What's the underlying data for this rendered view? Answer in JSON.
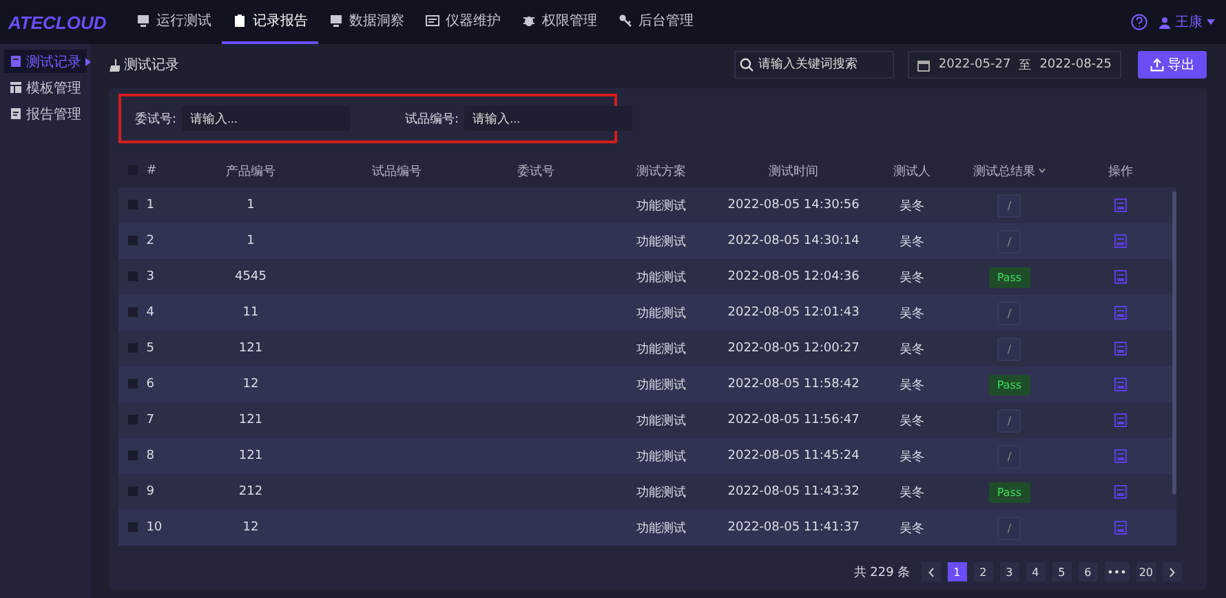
{
  "topbar": {
    "logo": "ATECLOUD",
    "nav": [
      {
        "label": "运行测试",
        "selected": false
      },
      {
        "label": "记录报告",
        "selected": true
      },
      {
        "label": "数据洞察",
        "selected": false
      },
      {
        "label": "仪器维护",
        "selected": false
      },
      {
        "label": "权限管理",
        "selected": false
      },
      {
        "label": "后台管理",
        "selected": false
      }
    ],
    "user": "王康"
  },
  "sidebar": {
    "items": [
      {
        "label": "测试记录",
        "selected": true
      },
      {
        "label": "模板管理",
        "selected": false
      },
      {
        "label": "报告管理",
        "selected": false
      }
    ]
  },
  "breadcrumb": "测试记录",
  "search": {
    "placeholder": "请输入关键词搜索"
  },
  "date_range": {
    "start": "2022-05-27",
    "separator": "至",
    "end": "2022-08-25"
  },
  "export_button": "导出",
  "filters": [
    {
      "label": "委试号:",
      "placeholder": "请输入..."
    },
    {
      "label": "试品编号:",
      "placeholder": "请输入..."
    }
  ],
  "table": {
    "select_all_checked": false,
    "columns": [
      "#",
      "产品编号",
      "试品编号",
      "委试号",
      "测试方案",
      "测试时间",
      "测试人",
      "测试总结果",
      "操作"
    ],
    "rows": [
      {
        "checked": false,
        "no": "1",
        "product": "1",
        "plan": "功能测试",
        "time": "2022-08-05 14:30:56",
        "tester": "吴冬",
        "result": {
          "kind": "none",
          "text": "/"
        }
      },
      {
        "checked": false,
        "no": "2",
        "product": "1",
        "plan": "功能测试",
        "time": "2022-08-05 14:30:14",
        "tester": "吴冬",
        "result": {
          "kind": "none",
          "text": "/"
        }
      },
      {
        "checked": false,
        "no": "3",
        "product": "4545",
        "plan": "功能测试",
        "time": "2022-08-05 12:04:36",
        "tester": "吴冬",
        "result": {
          "kind": "pass",
          "text": "Pass"
        }
      },
      {
        "checked": false,
        "no": "4",
        "product": "11",
        "plan": "功能测试",
        "time": "2022-08-05 12:01:43",
        "tester": "吴冬",
        "result": {
          "kind": "none",
          "text": "/"
        }
      },
      {
        "checked": false,
        "no": "5",
        "product": "121",
        "plan": "功能测试",
        "time": "2022-08-05 12:00:27",
        "tester": "吴冬",
        "result": {
          "kind": "none",
          "text": "/"
        }
      },
      {
        "checked": false,
        "no": "6",
        "product": "12",
        "plan": "功能测试",
        "time": "2022-08-05 11:58:42",
        "tester": "吴冬",
        "result": {
          "kind": "pass",
          "text": "Pass"
        }
      },
      {
        "checked": false,
        "no": "7",
        "product": "121",
        "plan": "功能测试",
        "time": "2022-08-05 11:56:47",
        "tester": "吴冬",
        "result": {
          "kind": "none",
          "text": "/"
        }
      },
      {
        "checked": false,
        "no": "8",
        "product": "121",
        "plan": "功能测试",
        "time": "2022-08-05 11:45:24",
        "tester": "吴冬",
        "result": {
          "kind": "none",
          "text": "/"
        }
      },
      {
        "checked": false,
        "no": "9",
        "product": "212",
        "plan": "功能测试",
        "time": "2022-08-05 11:43:32",
        "tester": "吴冬",
        "result": {
          "kind": "pass",
          "text": "Pass"
        }
      },
      {
        "checked": false,
        "no": "10",
        "product": "12",
        "plan": "功能测试",
        "time": "2022-08-05 11:41:37",
        "tester": "吴冬",
        "result": {
          "kind": "none",
          "text": "/"
        }
      }
    ]
  },
  "pagination": {
    "total": "共 229 条",
    "pages": [
      {
        "label": "1",
        "selected": true
      },
      {
        "label": "2",
        "selected": false
      },
      {
        "label": "3",
        "selected": false
      },
      {
        "label": "4",
        "selected": false
      },
      {
        "label": "5",
        "selected": false
      },
      {
        "label": "6",
        "selected": false
      },
      {
        "label": "•••",
        "selected": false
      },
      {
        "label": "20",
        "selected": false
      }
    ]
  }
}
